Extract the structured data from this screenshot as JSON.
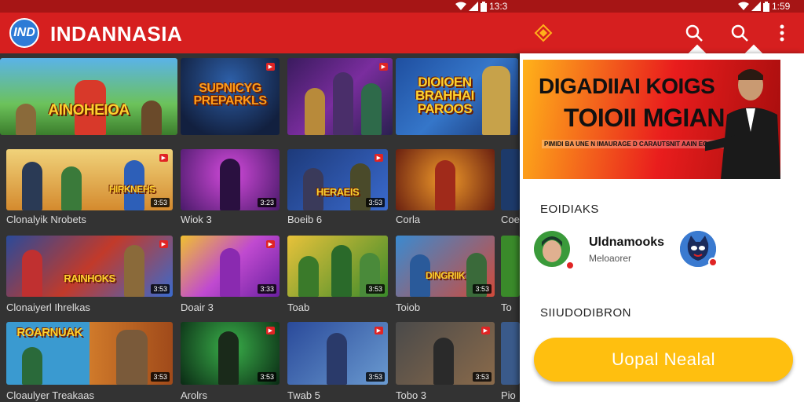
{
  "status_bar": {
    "time_left": "13:3",
    "time_right": "1:59"
  },
  "app_bar": {
    "logo_text": "IND",
    "title": "INDANNASIA",
    "icons": [
      "diamond-icon",
      "search-icon",
      "search-icon",
      "more-vert-icon"
    ]
  },
  "grid": {
    "items": [
      {
        "art": "AINOHEIOA",
        "caption": "",
        "duration": ""
      },
      {
        "art": "SUPNICYG PREPARKLS",
        "caption": "",
        "duration": ""
      },
      {
        "art": "",
        "caption": "",
        "duration": ""
      },
      {
        "art": "DIOIOEN BRAHHAI PAROOS",
        "caption": "",
        "duration": ""
      },
      {
        "art": "HIRKNEHS",
        "caption": "Clonalyik Nrobets",
        "duration": "3:53"
      },
      {
        "art": "",
        "caption": "Wiok 3",
        "duration": "3:23"
      },
      {
        "art": "HERAEIS",
        "caption": "Boeib 6",
        "duration": "3:53"
      },
      {
        "art": "",
        "caption": "Corla",
        "duration": ""
      },
      {
        "art": "",
        "caption": "Coe",
        "duration": ""
      },
      {
        "art": "RAINHOKS",
        "caption": "Clonaiyerl Ihrelkas",
        "duration": "3:53"
      },
      {
        "art": "",
        "caption": "Doair 3",
        "duration": "3:33"
      },
      {
        "art": "",
        "caption": "Toab",
        "duration": "3:53"
      },
      {
        "art": "DINGRIIK",
        "caption": "Toiob",
        "duration": "3:53"
      },
      {
        "art": "",
        "caption": "To",
        "duration": ""
      },
      {
        "art": "ROARNUAK",
        "caption": "Cloaulyer Treakaas",
        "duration": "3:53"
      },
      {
        "art": "",
        "caption": "Arolrs",
        "duration": "3:53"
      },
      {
        "art": "",
        "caption": "Twab 5",
        "duration": "3:53"
      },
      {
        "art": "",
        "caption": "Tobo 3",
        "duration": "3:53"
      },
      {
        "art": "",
        "caption": "Pio",
        "duration": ""
      }
    ]
  },
  "side_panel": {
    "banner": {
      "line1": "DIGADIIAI KOIGS",
      "line2": "TOIOII MGIAN",
      "sub": "PIMIDI BA UNE N IMAURAGE D CARAUTSNIT AAIN EC OCACAC. CAIDR CINDRAHER"
    },
    "section1": "EOIDIAKS",
    "channel_name": "Uldnamooks",
    "channel_sub": "Meloaorer",
    "section2": "SIIUDODIBRON",
    "cta_label": "Uopal Nealal"
  },
  "colors": {
    "app_bar": "#d61f1f",
    "status_bar": "#a61515",
    "cta": "#ffbf0f",
    "panel": "#ffffff",
    "grid_bg": "#333333"
  }
}
